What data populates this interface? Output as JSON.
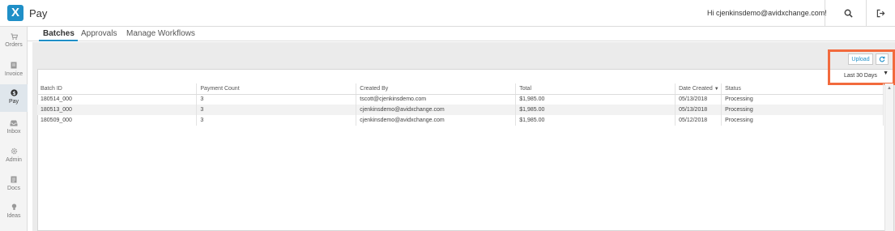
{
  "app": {
    "title": "Pay",
    "logo_letter": "X",
    "greeting": "Hi cjenkinsdemo@avidxchange.com!"
  },
  "sidebar": {
    "items": [
      {
        "label": "Orders",
        "icon": "cart-icon",
        "active": false
      },
      {
        "label": "Invoice",
        "icon": "invoice-icon",
        "active": false
      },
      {
        "label": "Pay",
        "icon": "dollar-icon",
        "active": true
      },
      {
        "label": "Inbox",
        "icon": "inbox-icon",
        "active": false
      },
      {
        "label": "Admin",
        "icon": "gear-icon",
        "active": false
      },
      {
        "label": "Docs",
        "icon": "docs-icon",
        "active": false
      },
      {
        "label": "Ideas",
        "icon": "lightbulb-icon",
        "active": false
      }
    ]
  },
  "tabs": [
    {
      "label": "Batches",
      "active": true
    },
    {
      "label": "Approvals",
      "active": false
    },
    {
      "label": "Manage Workflows",
      "active": false
    }
  ],
  "toolbar": {
    "upload_label": "Upload",
    "date_range": "Last 30 Days"
  },
  "table": {
    "columns": [
      "Batch ID",
      "Payment Count",
      "Created By",
      "Total",
      "Date Created",
      "Status"
    ],
    "rows": [
      [
        "180514_000",
        "3",
        "tscott@cjenkinsdemo.com",
        "$1,985.00",
        "05/13/2018",
        "Processing"
      ],
      [
        "180513_000",
        "3",
        "cjenkinsdemo@avidxchange.com",
        "$1,985.00",
        "05/13/2018",
        "Processing"
      ],
      [
        "180509_000",
        "3",
        "cjenkinsdemo@avidxchange.com",
        "$1,985.00",
        "05/12/2018",
        "Processing"
      ]
    ]
  },
  "colors": {
    "brand": "#1f8fc7",
    "highlight": "#f26a3d"
  }
}
